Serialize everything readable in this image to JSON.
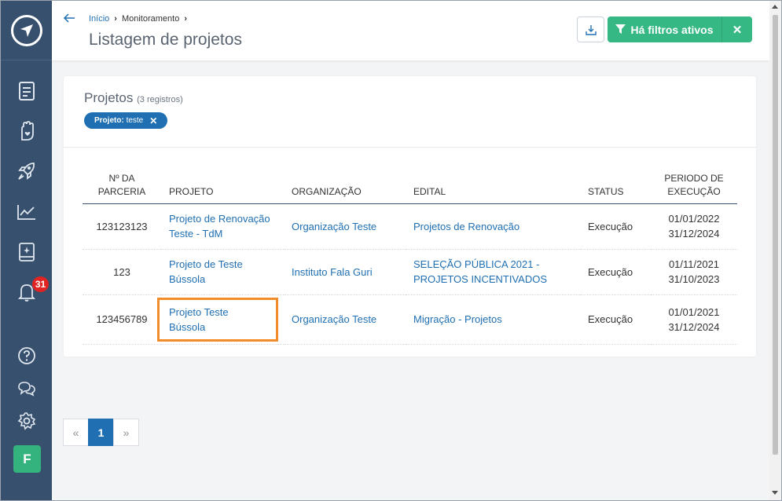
{
  "sidebar": {
    "badge_count": "31",
    "avatar_letter": "F"
  },
  "header": {
    "breadcrumb": [
      "Início",
      "Monitoramento"
    ],
    "title": "Listagem de projetos",
    "filter_label": "Há filtros ativos",
    "filter_clear": "✕"
  },
  "card": {
    "title": "Projetos",
    "count": "(3 registros)",
    "chip_key": "Projeto:",
    "chip_value": "teste",
    "chip_close": "✕"
  },
  "table": {
    "headers": {
      "parceria": "Nº DA PARCERIA",
      "projeto": "PROJETO",
      "organizacao": "ORGANIZAÇÃO",
      "edital": "EDITAL",
      "status": "STATUS",
      "periodo": "PERIODO DE EXECUÇÃO"
    },
    "rows": [
      {
        "parceria": "123123123",
        "projeto": "Projeto de Renovação Teste - TdM",
        "organizacao": "Organização Teste",
        "edital": "Projetos de Renovação",
        "status": "Execução",
        "inicio": "01/01/2022",
        "fim": "31/12/2024"
      },
      {
        "parceria": "123",
        "projeto": "Projeto de Teste Bússola",
        "organizacao": "Instituto Fala Guri",
        "edital": "SELEÇÃO PÚBLICA 2021 - PROJETOS INCENTIVADOS",
        "status": "Execução",
        "inicio": "01/11/2021",
        "fim": "31/10/2023"
      },
      {
        "parceria": "123456789",
        "projeto": "Projeto Teste Bússola",
        "organizacao": "Organização Teste",
        "edital": "Migração - Projetos",
        "status": "Execução",
        "inicio": "01/01/2021",
        "fim": "31/12/2024"
      }
    ]
  },
  "pagination": {
    "prev": "«",
    "current": "1",
    "next": "»"
  },
  "colors": {
    "sidebar": "#37506e",
    "link": "#1f6fb2",
    "accent_green": "#35b884",
    "highlight": "#f28c28",
    "badge": "#e02424"
  }
}
